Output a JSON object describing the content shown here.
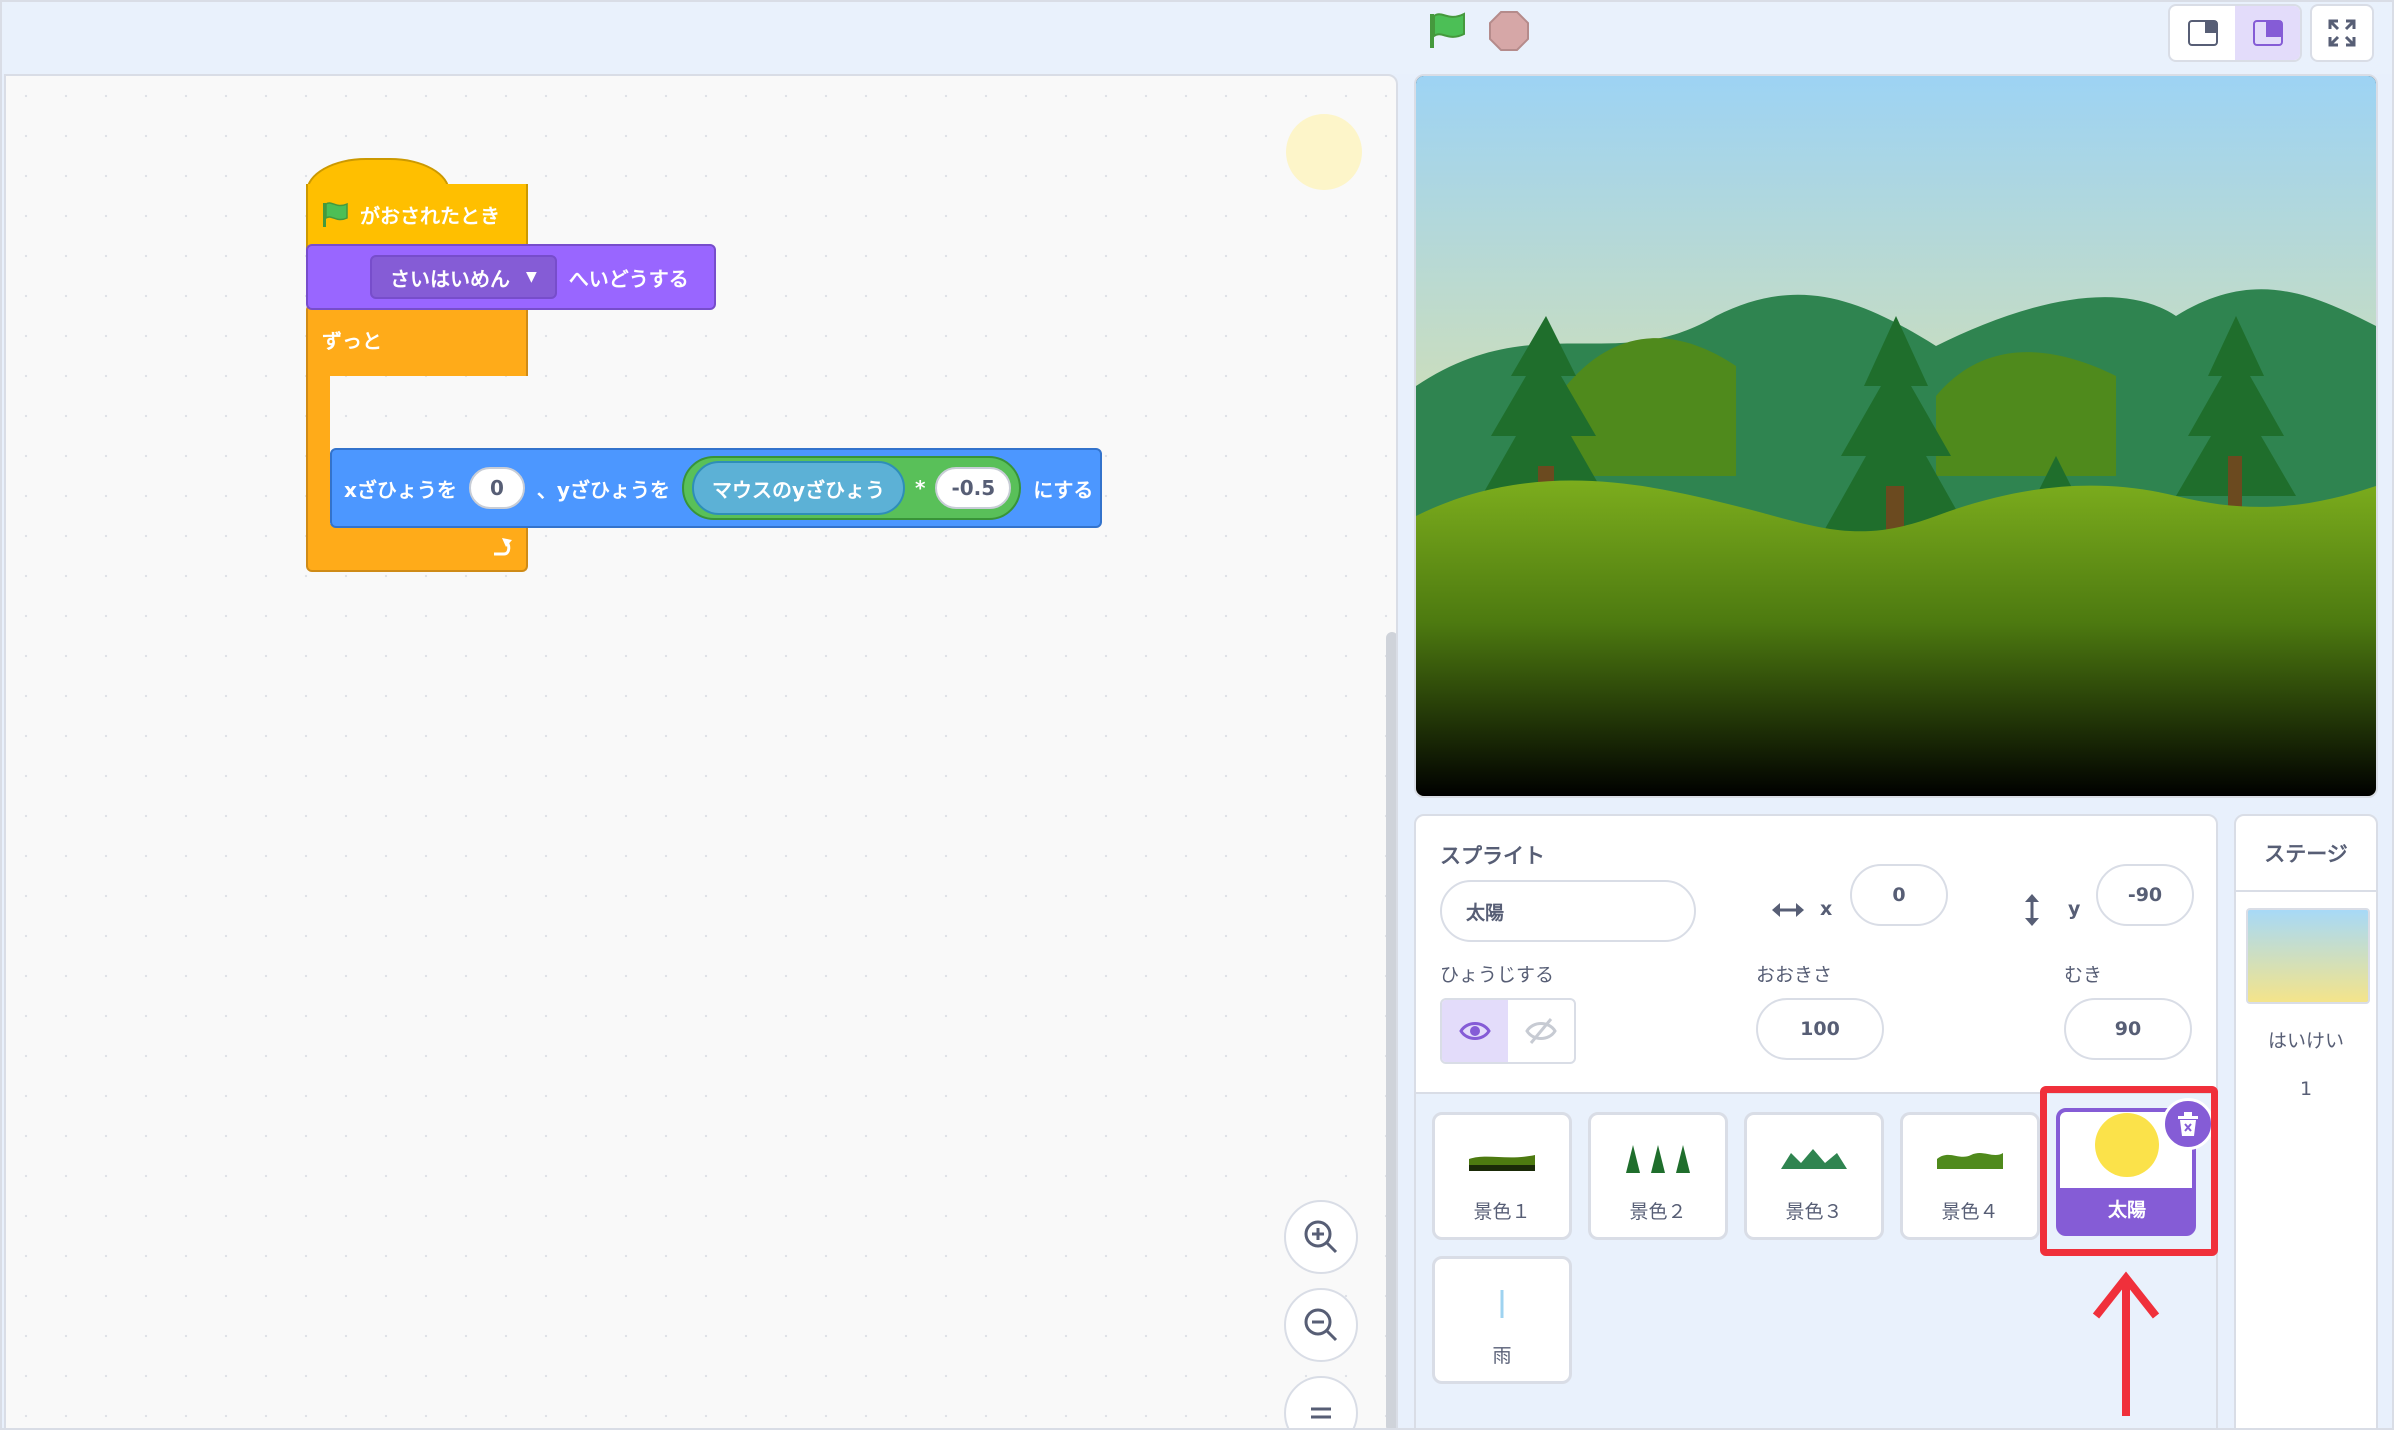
{
  "toolbar": {
    "green_flag_icon": "green-flag-icon",
    "stop_icon": "stop-icon",
    "colors": {
      "flag": "#4cbf56",
      "stop": "#d6a7a7"
    }
  },
  "code": {
    "hat_label": "がおされたとき",
    "looks_menu_value": "さいはいめん",
    "looks_suffix": "へいどうする",
    "forever_label": "ずっと",
    "goto_x_label": "xざひょうを",
    "goto_x_value": "0",
    "goto_sep": "、yざひょうを",
    "sensing_label": "マウスのyざひょう",
    "operator_symbol": "*",
    "operator_value": "-0.5",
    "goto_suffix": "にする",
    "colors": {
      "events": "#ffbf00",
      "looks": "#9966ff",
      "control": "#ffab19",
      "motion": "#4c97ff",
      "operators": "#59c059",
      "sensing": "#5cb1d6"
    }
  },
  "sprite_info": {
    "header": "スプライト",
    "name_value": "太陽",
    "x_label": "x",
    "x_value": "0",
    "y_label": "y",
    "y_value": "-90",
    "show_label": "ひょうじする",
    "size_label": "おおきさ",
    "size_value": "100",
    "direction_label": "むき",
    "direction_value": "90",
    "visible": true
  },
  "sprites": [
    {
      "name": "景色１",
      "icon": "landscape-1-thumbnail"
    },
    {
      "name": "景色２",
      "icon": "landscape-2-thumbnail"
    },
    {
      "name": "景色３",
      "icon": "landscape-3-thumbnail"
    },
    {
      "name": "景色４",
      "icon": "landscape-4-thumbnail"
    },
    {
      "name": "太陽",
      "icon": "sun-thumbnail",
      "selected": true
    },
    {
      "name": "雨",
      "icon": "rain-thumbnail"
    }
  ],
  "stage_pane": {
    "title": "ステージ",
    "backdrop_label": "はいけい",
    "backdrop_count": "1"
  },
  "annotation": {
    "color": "#f0303b"
  }
}
